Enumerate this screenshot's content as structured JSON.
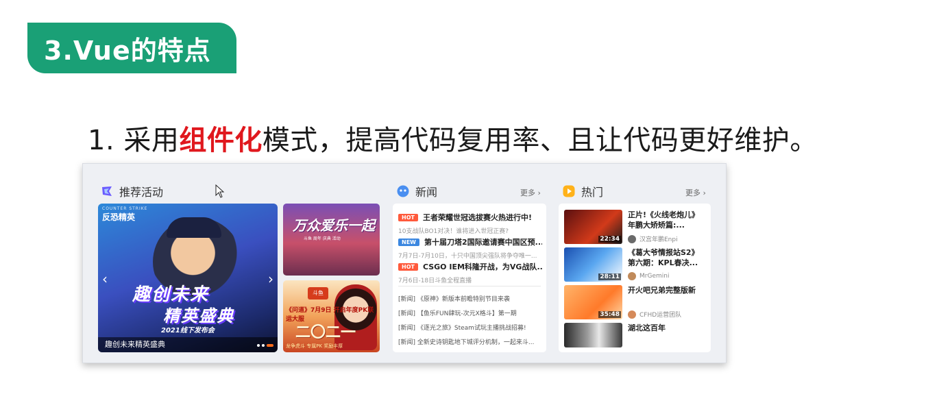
{
  "slide": {
    "title": "3.Vue的特点",
    "bullet_prefix": "1. 采用",
    "bullet_highlight": "组件化",
    "bullet_suffix": "模式，提高代码复用率、且让代码更好维护。",
    "colors": {
      "badge": "#1aa076",
      "highlight": "#e0181e"
    }
  },
  "panel": {
    "recommend": {
      "heading": "推荐活动",
      "icon": "recommend-icon",
      "main_banner": {
        "logo": "反恐精英",
        "logo_small": "COUNTER STRIKE",
        "headline1": "趣创未来",
        "headline2": "精英盛典",
        "subline": "2021线下发布会",
        "caption": "趣创未来精英盛典",
        "nav_prev": "‹",
        "nav_next": "›"
      },
      "banner2": {
        "text": "万众爱乐一起",
        "sub": "斗鱼 周年 庆典 活动"
      },
      "banner3": {
        "tag": "斗鱼",
        "text": "《问道》7月9日 开启年度PK联运大服",
        "big": "二〇二一",
        "bottom": "龙争虎斗 专属PK 奖励丰厚"
      }
    },
    "news": {
      "heading": "新闻",
      "icon": "news-icon",
      "more": "更多 ›",
      "items": [
        {
          "tag": "HOT",
          "title": "王者荣耀世冠选拔赛火热进行中!",
          "desc": "10支战队BO1对决！谁将进入世冠正赛?"
        },
        {
          "tag": "NEW",
          "title": "第十届刀塔2国际邀请赛中国区预...",
          "desc": "7月7日-7月10日，十只中国顶尖强队将争夺唯一..."
        },
        {
          "tag": "HOT",
          "title": "CSGO IEM科隆开战，为VG战队...",
          "desc": "7月6日-18日斗鱼全程直播"
        }
      ],
      "small_items": [
        "[新闻] 《原神》新版本前瞻特别节目来袭",
        "[新闻] 【鱼乐FUN肆玩-次元X格斗】第一期",
        "[新闻] 《逐光之旅》Steam试玩主播挑战招募!",
        "[新闻] 全新史诗钥匙地下城评分机制，一起来斗..."
      ]
    },
    "hot": {
      "heading": "热门",
      "icon": "hot-icon",
      "more": "更多 ›",
      "items": [
        {
          "title": "正片!《火线老炮儿》年鹏大矫矫篇:...",
          "author": "汉宫年鹏Enpi",
          "duration": "22:34"
        },
        {
          "title": "《葛大爷情报站S2》第六期：KPL春决...",
          "author": "MrGemini",
          "duration": "28:11"
        },
        {
          "title": "开火吧兄弟完整版新",
          "author": "CFHD运营团队",
          "duration": "35:48"
        },
        {
          "title": "湖北这百年",
          "author": "",
          "duration": ""
        }
      ]
    }
  }
}
